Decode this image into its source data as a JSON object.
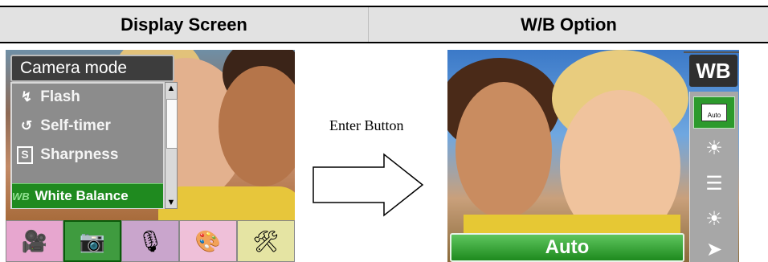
{
  "header": {
    "left_title": "Display Screen",
    "right_title": "W/B Option"
  },
  "left_screen": {
    "mode_title": "Camera mode",
    "menu_items": [
      {
        "icon": "flash-icon",
        "glyph": "↯",
        "label": "Flash"
      },
      {
        "icon": "self-timer-icon",
        "glyph": "↺",
        "label": "Self-timer"
      },
      {
        "icon": "sharpness-icon",
        "glyph": "S",
        "label": "Sharpness"
      }
    ],
    "selected_item": {
      "icon": "wb-icon",
      "glyph": "WB",
      "label": "White Balance"
    },
    "scroll_up": "▲",
    "scroll_down": "▼",
    "tray": [
      "video-camera-icon",
      "camera-icon",
      "microphone-icon",
      "palette-icon",
      "settings-tools-icon"
    ],
    "tray_glyphs": [
      "🎥",
      "📷",
      "🎙",
      "🎨",
      "🛠"
    ]
  },
  "middle": {
    "enter_label": "Enter Button"
  },
  "right_screen": {
    "badge": "WB",
    "options": [
      {
        "icon": "auto-wb-icon",
        "label": "Auto"
      },
      {
        "icon": "sunny-icon",
        "glyph": "☀"
      },
      {
        "icon": "fluorescent-icon",
        "glyph": "☰"
      },
      {
        "icon": "tungsten-bulb-icon",
        "glyph": "☀"
      },
      {
        "icon": "exit-icon",
        "glyph": "➤"
      }
    ],
    "current_value": "Auto"
  },
  "colors": {
    "selection_green": "#1f8a1f",
    "menu_gray": "#8c8c8c"
  }
}
